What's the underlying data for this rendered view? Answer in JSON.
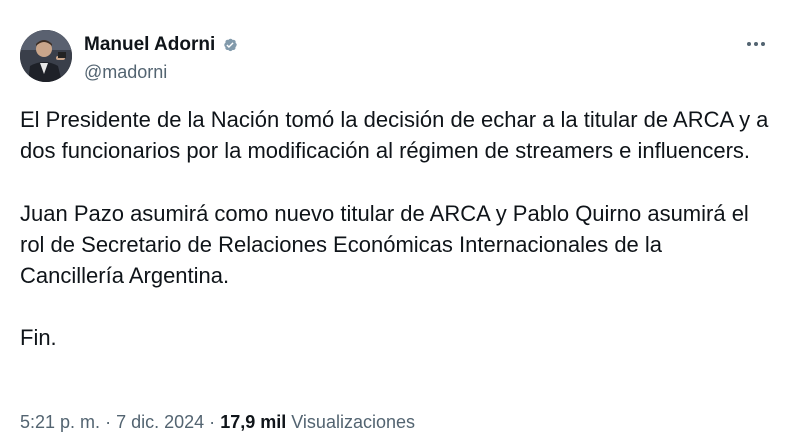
{
  "author": {
    "display_name": "Manuel Adorni",
    "handle": "@madorni",
    "verified_badge_color": "#829aab"
  },
  "tweet": {
    "paragraph_1": "El Presidente de la Nación tomó la decisión de echar a la titular de ARCA y a dos funcionarios por la modificación al régimen de streamers e influencers.",
    "paragraph_2": "Juan Pazo asumirá como nuevo titular de ARCA y Pablo Quirno asumirá el rol de Secretario de Relaciones Económicas Internacionales de la Cancillería Argentina.",
    "paragraph_3": "Fin."
  },
  "meta": {
    "time": "5:21 p. m.",
    "separator_1": "·",
    "date": "7 dic. 2024",
    "separator_2": "·",
    "views_count": "17,9 mil",
    "views_label": "Visualizaciones"
  },
  "icons": {
    "verified": "verified-badge-icon",
    "more": "more-options-icon"
  },
  "colors": {
    "text_primary": "#0f1419",
    "text_secondary": "#536471"
  }
}
